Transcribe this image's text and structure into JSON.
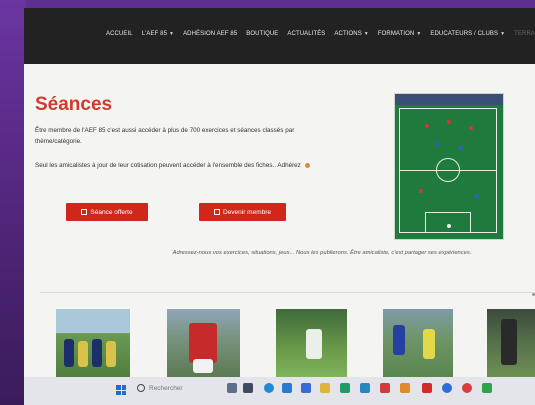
{
  "nav": {
    "items": [
      {
        "label": "ACCUEIL",
        "dropdown": false
      },
      {
        "label": "L'AEF 85",
        "dropdown": true
      },
      {
        "label": "ADHÉSION AEF 85",
        "dropdown": false
      },
      {
        "label": "BOUTIQUE",
        "dropdown": false
      },
      {
        "label": "ACTUALITÉS",
        "dropdown": false
      },
      {
        "label": "ACTIONS",
        "dropdown": true
      },
      {
        "label": "FORMATION",
        "dropdown": true
      },
      {
        "label": "EDUCATEURS / CLUBS",
        "dropdown": true
      },
      {
        "label": "TERRA",
        "dropdown": false
      }
    ]
  },
  "main": {
    "title": "Séances",
    "intro": "Être membre de l'AEF 85 c'est aussi accéder à plus de 700 exercices et séances classés par thème/catégorie.",
    "members_text": "Seul les amicalistes à jour de leur cotisation peuvent accéder à l'ensemble des fiches.. Adhérez",
    "btn_seance": "Séance offerte",
    "btn_devenir": "Devenir membre",
    "caption": "Adressez-nous vos exercices, situations, jeux... Nous les publierons. Être amicaliste, c'est partager ses expériences."
  },
  "taskbar": {
    "search_label": "Rechercher"
  },
  "colors": {
    "accent_red": "#d1271b",
    "title_red": "#d0392b",
    "nav_bg": "#222222",
    "field_green": "#1f7a3e"
  },
  "icons": {
    "button_icon": "edit-icon",
    "taskbar": [
      "windows-start-icon",
      "search-icon",
      "folder-icon",
      "edge-icon",
      "store-icon",
      "mail-icon"
    ]
  }
}
